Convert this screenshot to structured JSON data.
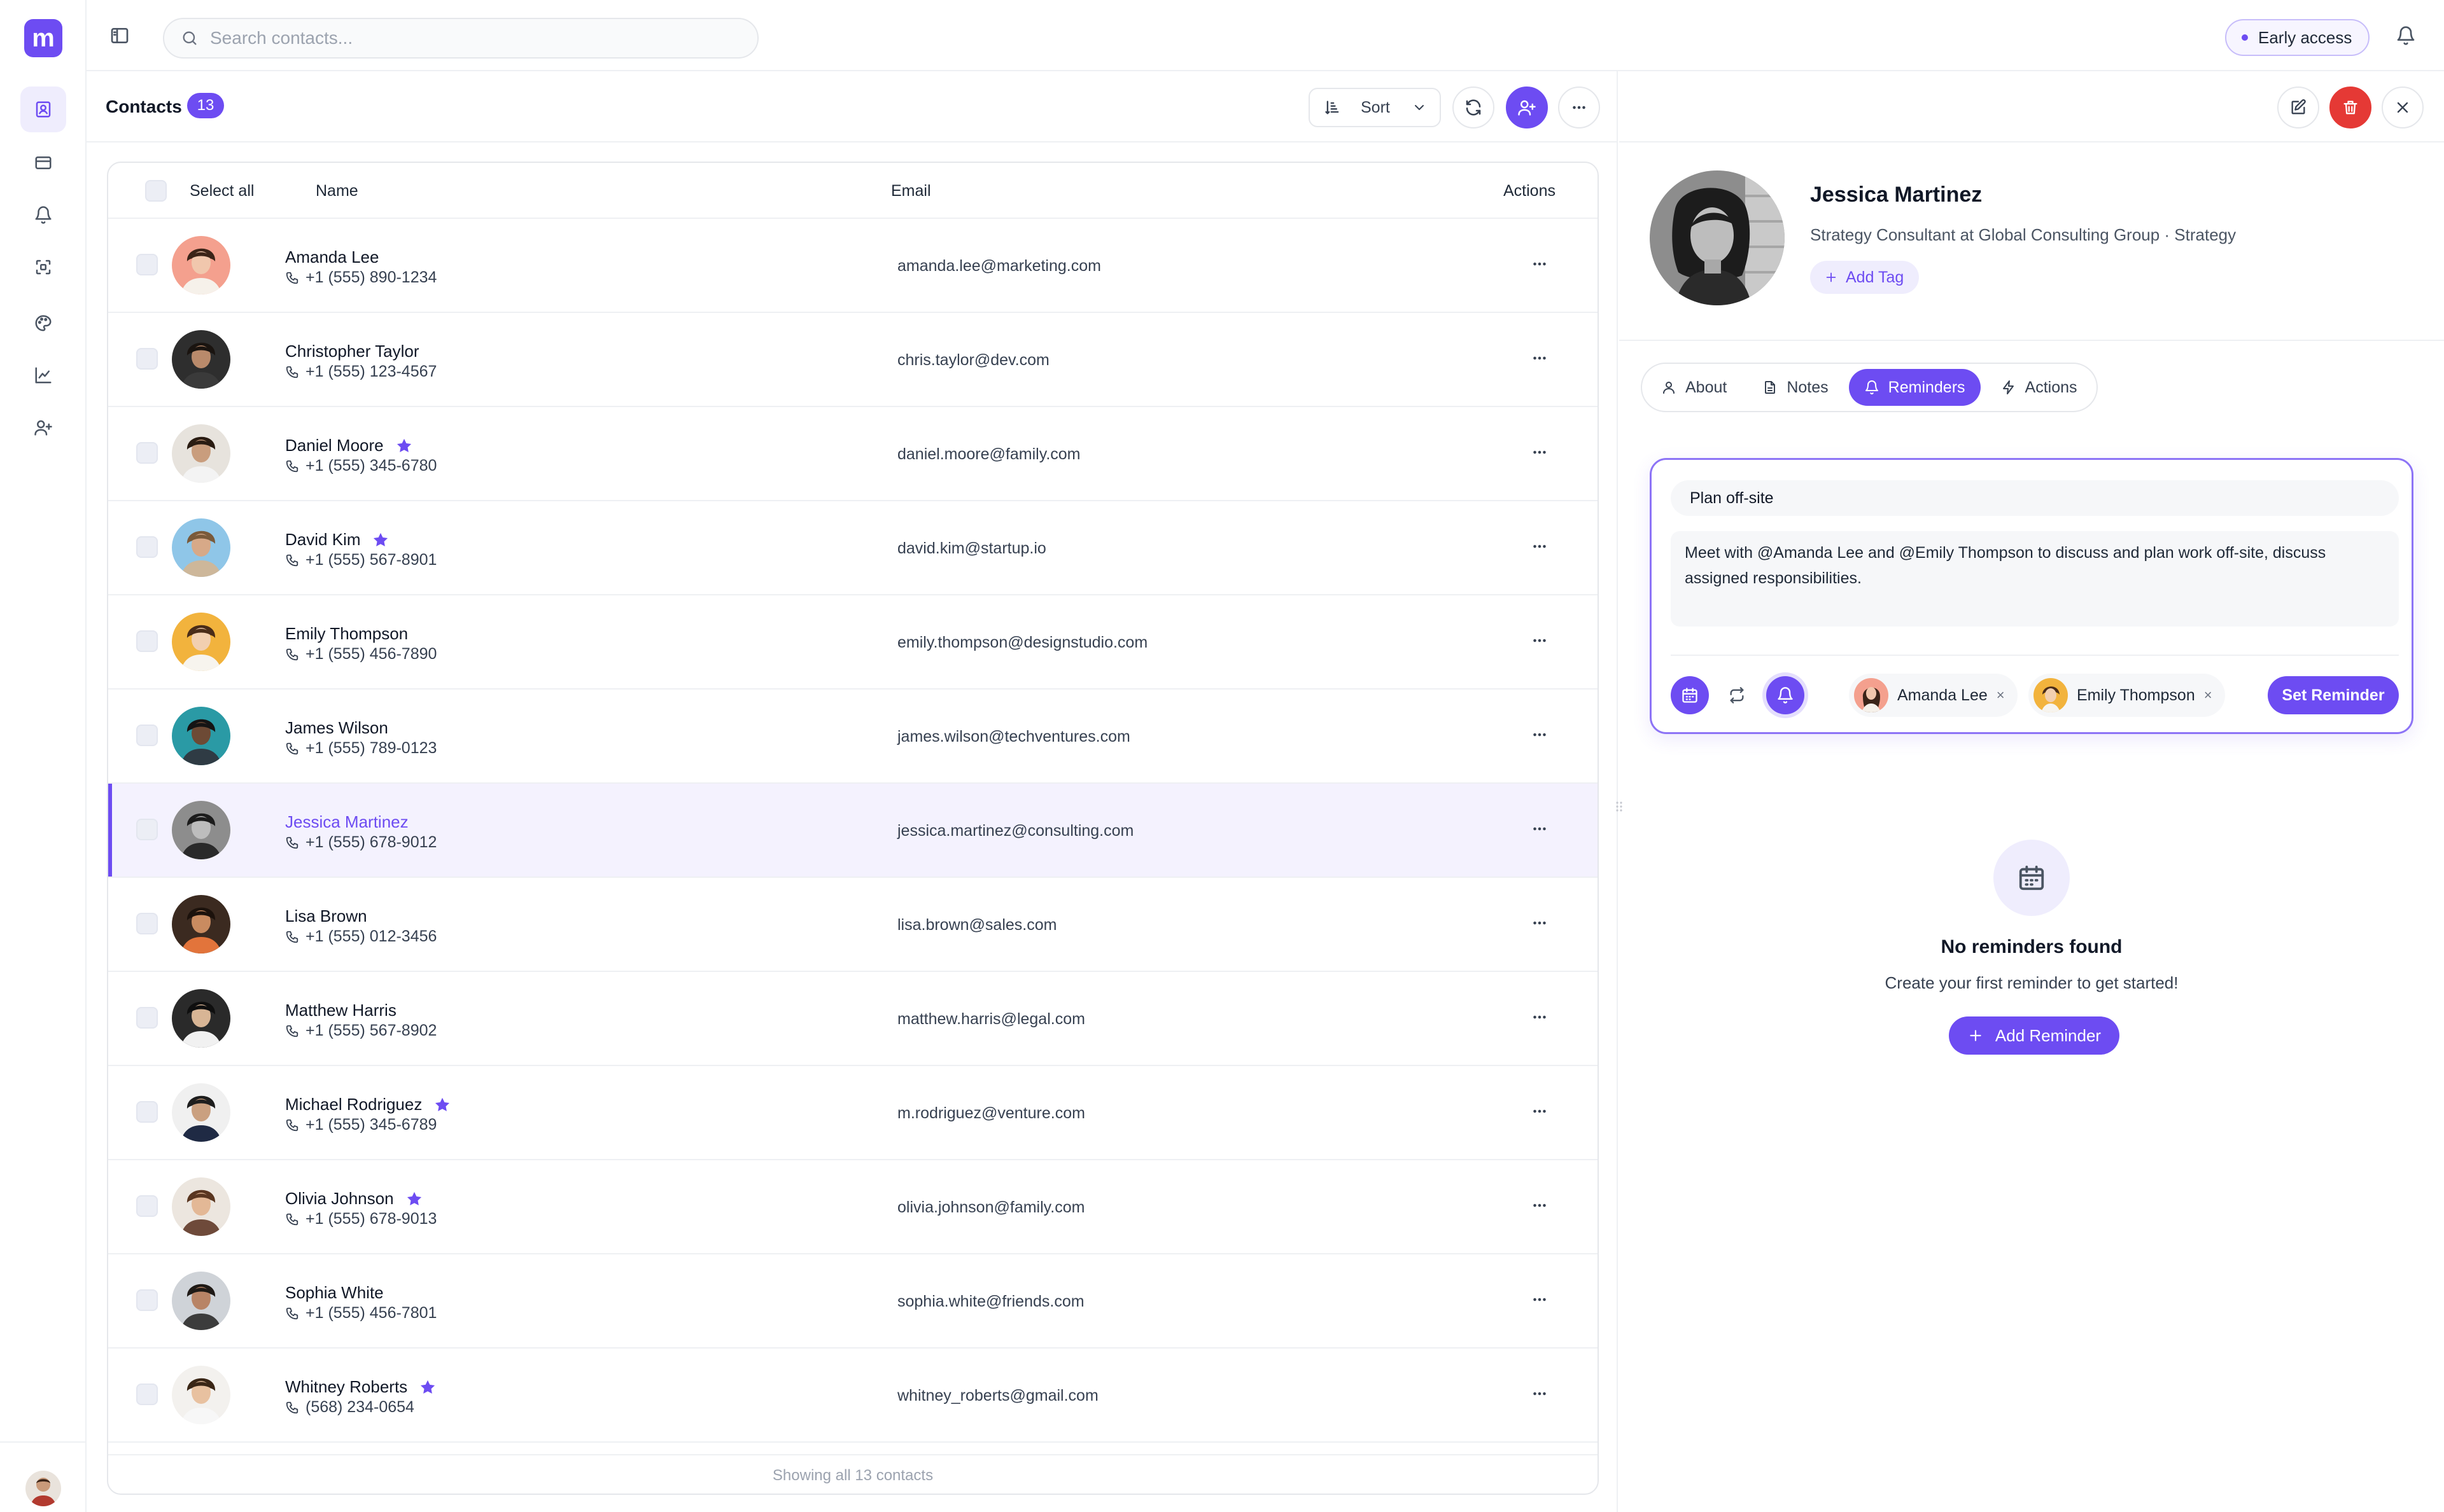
{
  "app": {
    "logo_letter": "m",
    "accent": "#6d4cf2",
    "danger": "#e53935"
  },
  "rail": {
    "icons": [
      "contacts-icon",
      "card-icon",
      "bell-icon",
      "scan-icon",
      "palette-icon",
      "chart-icon",
      "user-plus-icon"
    ]
  },
  "topbar": {
    "search_placeholder": "Search contacts...",
    "early_access": "Early access"
  },
  "contacts": {
    "title": "Contacts",
    "count": "13",
    "sort_label": "Sort",
    "table": {
      "select_all": "Select all",
      "col_name": "Name",
      "col_email": "Email",
      "col_actions": "Actions"
    },
    "rows": [
      {
        "name": "Amanda Lee",
        "phone": "+1 (555) 890-1234",
        "email": "amanda.lee@marketing.com",
        "starred": false,
        "selected": false
      },
      {
        "name": "Christopher Taylor",
        "phone": "+1 (555) 123-4567",
        "email": "chris.taylor@dev.com",
        "starred": false,
        "selected": false
      },
      {
        "name": "Daniel Moore",
        "phone": "+1 (555) 345-6780",
        "email": "daniel.moore@family.com",
        "starred": true,
        "selected": false
      },
      {
        "name": "David Kim",
        "phone": "+1 (555) 567-8901",
        "email": "david.kim@startup.io",
        "starred": true,
        "selected": false
      },
      {
        "name": "Emily Thompson",
        "phone": "+1 (555) 456-7890",
        "email": "emily.thompson@designstudio.com",
        "starred": false,
        "selected": false
      },
      {
        "name": "James Wilson",
        "phone": "+1 (555) 789-0123",
        "email": "james.wilson@techventures.com",
        "starred": false,
        "selected": false
      },
      {
        "name": "Jessica Martinez",
        "phone": "+1 (555) 678-9012",
        "email": "jessica.martinez@consulting.com",
        "starred": false,
        "selected": true
      },
      {
        "name": "Lisa Brown",
        "phone": "+1 (555) 012-3456",
        "email": "lisa.brown@sales.com",
        "starred": false,
        "selected": false
      },
      {
        "name": "Matthew Harris",
        "phone": "+1 (555) 567-8902",
        "email": "matthew.harris@legal.com",
        "starred": false,
        "selected": false
      },
      {
        "name": "Michael Rodriguez",
        "phone": "+1 (555) 345-6789",
        "email": "m.rodriguez@venture.com",
        "starred": true,
        "selected": false
      },
      {
        "name": "Olivia Johnson",
        "phone": "+1 (555) 678-9013",
        "email": "olivia.johnson@family.com",
        "starred": true,
        "selected": false
      },
      {
        "name": "Sophia White",
        "phone": "+1 (555) 456-7801",
        "email": "sophia.white@friends.com",
        "starred": false,
        "selected": false
      },
      {
        "name": "Whitney Roberts",
        "phone": "(568) 234-0654",
        "email": "whitney_roberts@gmail.com",
        "starred": true,
        "selected": false
      }
    ],
    "footer": "Showing all 13 contacts"
  },
  "detail": {
    "name": "Jessica Martinez",
    "subtitle": "Strategy Consultant at Global Consulting Group · Strategy",
    "add_tag": "Add Tag",
    "tabs": [
      {
        "label": "About",
        "icon": "user-icon",
        "active": false
      },
      {
        "label": "Notes",
        "icon": "file-icon",
        "active": false
      },
      {
        "label": "Reminders",
        "icon": "bell-icon",
        "active": true
      },
      {
        "label": "Actions",
        "icon": "bolt-icon",
        "active": false
      }
    ],
    "reminder": {
      "title": "Plan off-site",
      "body": "Meet with @Amanda Lee and @Emily Thompson to discuss and plan work off-site, discuss assigned responsibilities.",
      "people": [
        "Amanda Lee",
        "Emily Thompson"
      ],
      "remove_symbol": "×",
      "submit": "Set Reminder"
    },
    "empty": {
      "title": "No reminders found",
      "subtitle": "Create your first reminder to get started!",
      "button": "Add Reminder"
    }
  }
}
